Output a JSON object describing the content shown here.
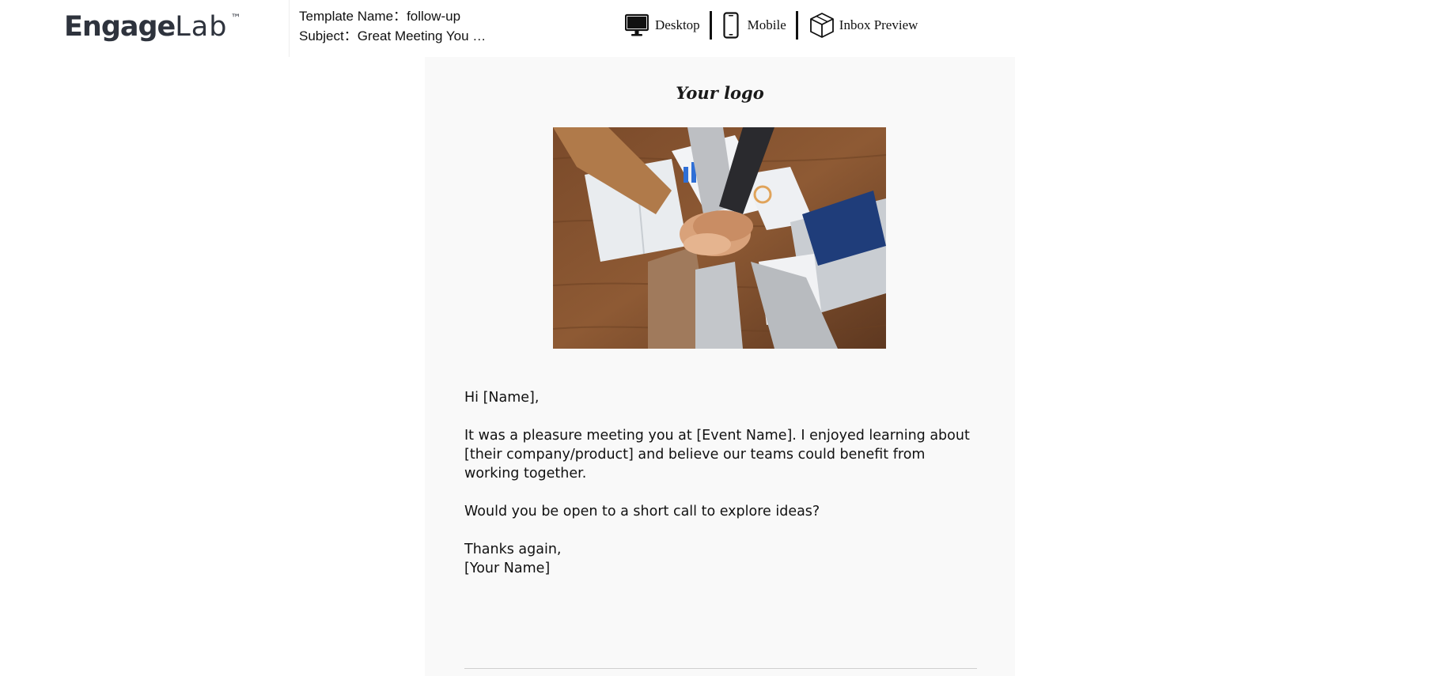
{
  "header": {
    "logo": {
      "engage": "Engage",
      "lab": "Lab",
      "tm": "™"
    },
    "template_name_label": "Template Name：",
    "template_name": "follow-up",
    "subject_label": "Subject：",
    "subject": "Great Meeting You …"
  },
  "view_switch": {
    "desktop": {
      "label": "Desktop",
      "icon": "desktop-icon"
    },
    "mobile": {
      "label": "Mobile",
      "icon": "mobile-icon"
    },
    "inbox": {
      "label": "Inbox Preview",
      "icon": "box-icon"
    }
  },
  "email": {
    "logo_text": "Your logo",
    "greeting": "Hi [Name],",
    "paragraph1": "It was a pleasure meeting you at [Event Name]. I enjoyed learning about [their company/product] and believe our teams could benefit from working together.",
    "paragraph2": "Would you be open to a short call to explore ideas?",
    "closing": "Thanks again,",
    "signature": "[Your Name]"
  },
  "colors": {
    "panel_bg": "#f9f9f9",
    "text": "#111111",
    "logo_accent": "#1e88e5"
  }
}
